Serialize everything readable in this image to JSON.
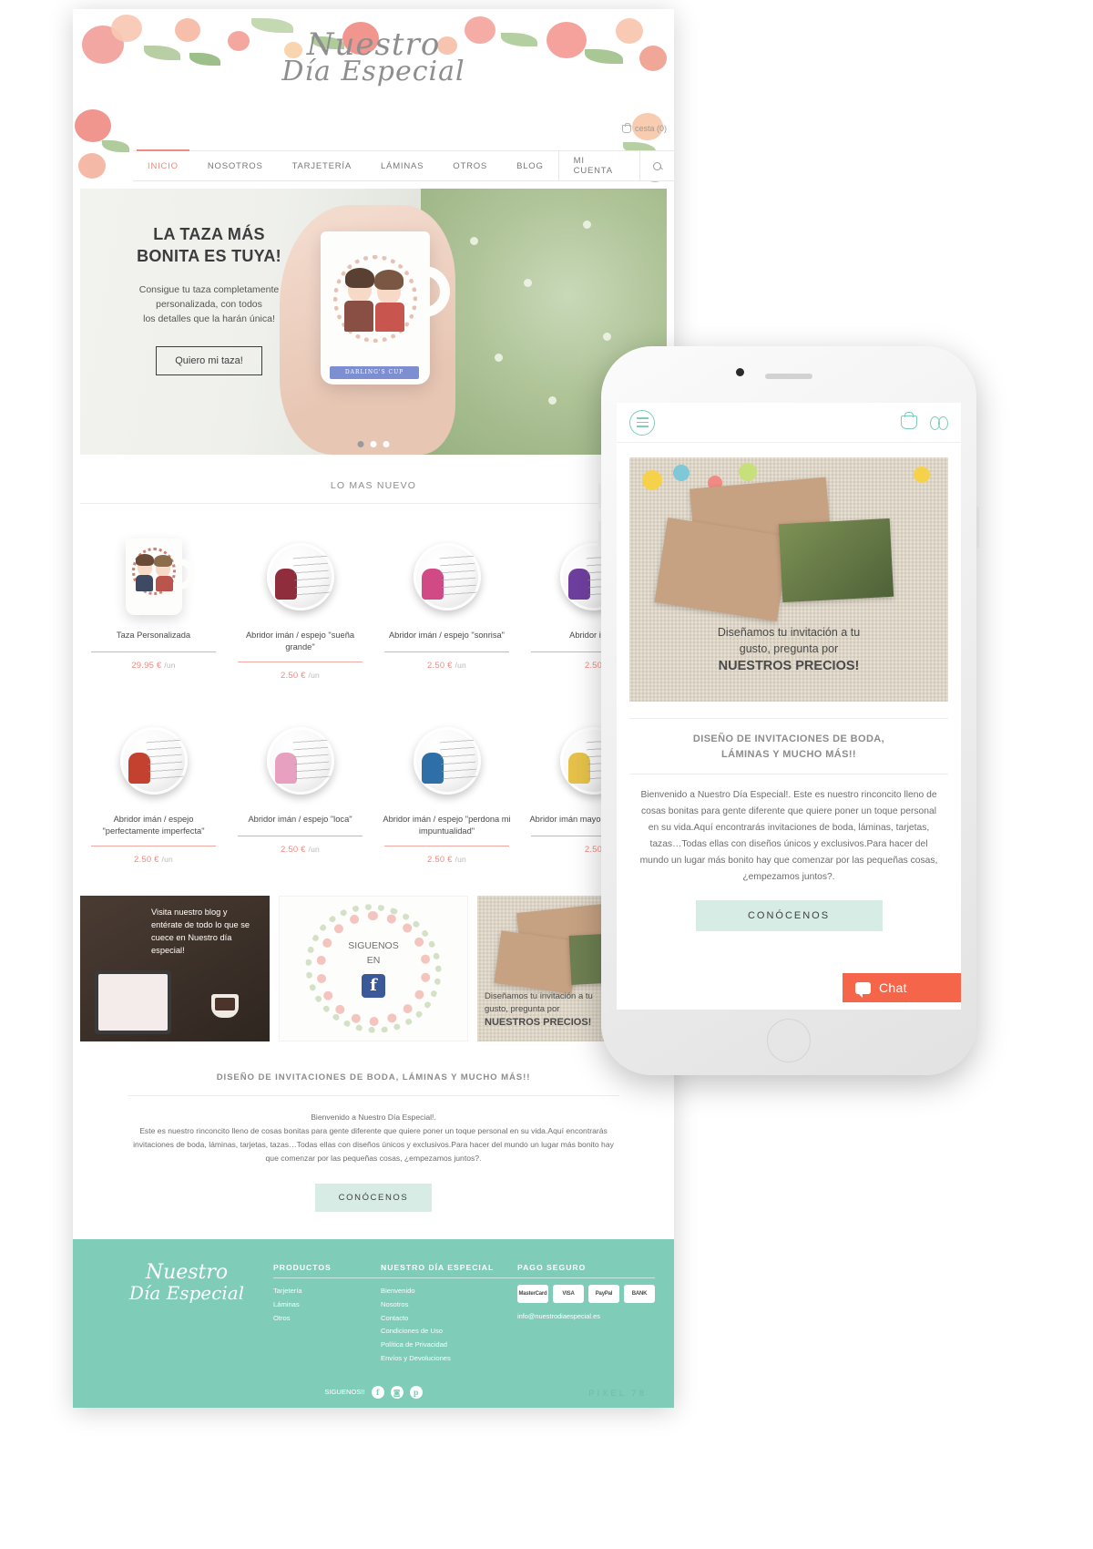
{
  "brand": {
    "name_line1": "Nuestro",
    "name_line2": "Día Especial",
    "accent": "#f08a82",
    "teal": "#7fcdb9",
    "teal_light": "#d6ece4",
    "chat_color": "#f4654a"
  },
  "header": {
    "cart_label": "cesta (0)",
    "cart_icon": "basket-icon",
    "search_icon": "search-icon"
  },
  "nav": {
    "items": [
      {
        "label": "INICIO",
        "active": true
      },
      {
        "label": "NOSOTROS",
        "active": false
      },
      {
        "label": "TARJETERÍA",
        "active": false
      },
      {
        "label": "LÁMINAS",
        "active": false
      },
      {
        "label": "OTROS",
        "active": false
      },
      {
        "label": "BLOG",
        "active": false
      },
      {
        "label": "MI CUENTA",
        "active": false
      }
    ]
  },
  "hero": {
    "heading_line1": "LA TAZA MÁS",
    "heading_line2": "BONITA ES TUYA!",
    "paragraph_line1": "Consigue tu taza completamente",
    "paragraph_line2": "personalizada, con todos",
    "paragraph_line3": "los detalles que la harán única!",
    "button_label": "Quiero mi taza!",
    "mug_ribbon": "DARLING'S CUP",
    "slides_total": 3,
    "slide_active": 1
  },
  "products_section": {
    "title": "LO MAS NUEVO",
    "items": [
      {
        "name": "Taza Personalizada",
        "price": "29.95 €",
        "unit": "/un",
        "kind": "mug"
      },
      {
        "name": "Abridor imán / espejo \"sueña grande\"",
        "price": "2.50 €",
        "unit": "/un",
        "kind": "badge"
      },
      {
        "name": "Abridor imán / espejo \"sonrisa\"",
        "price": "2.50 €",
        "unit": "/un",
        "kind": "badge"
      },
      {
        "name": "Abridor imán",
        "price": "2.50",
        "unit": "",
        "kind": "badge"
      },
      {
        "name": "Abridor imán / espejo \"perfectamente imperfecta\"",
        "price": "2.50 €",
        "unit": "/un",
        "kind": "badge"
      },
      {
        "name": "Abridor imán / espejo \"loca\"",
        "price": "2.50 €",
        "unit": "/un",
        "kind": "badge"
      },
      {
        "name": "Abridor imán / espejo \"perdona mi impuntualidad\"",
        "price": "2.50 €",
        "unit": "/un",
        "kind": "badge"
      },
      {
        "name": "Abridor imán mayor fracaso interé",
        "price": "2.50",
        "unit": "",
        "kind": "badge"
      }
    ]
  },
  "promos": [
    {
      "id": "blog",
      "text": "Visita nuestro blog y entérate de todo lo que se cuece en Nuestro día especial!"
    },
    {
      "id": "facebook",
      "line1": "SIGUENOS",
      "line2": "EN",
      "icon": "facebook-icon"
    },
    {
      "id": "invitaciones",
      "line1": "Diseñamos tu invitación a tu",
      "line2": "gusto, pregunta por",
      "strong": "NUESTROS PRECIOS!"
    }
  ],
  "about": {
    "heading": "DISEÑO DE INVITACIONES DE BODA, LÁMINAS Y MUCHO MÁS!!",
    "line1": "Bienvenido a Nuestro Día Especial!.",
    "line2": "Este es nuestro rinconcito lleno de cosas bonitas para gente diferente que quiere poner un toque personal en su vida.Aquí encontrarás invitaciones de boda, láminas, tarjetas, tazas…Todas ellas con diseños únicos y exclusivos.Para hacer del mundo un lugar más bonito hay que comenzar por las pequeñas cosas, ¿empezamos juntos?.",
    "cta": "CONÓCENOS"
  },
  "footer": {
    "columns": [
      {
        "title": "PRODUCTOS",
        "links": [
          "Tarjetería",
          "Láminas",
          "Otros"
        ]
      },
      {
        "title": "NUESTRO DÍA ESPECIAL",
        "links": [
          "Bienvenido",
          "Nosotros",
          "Contacto",
          "Condiciones de Uso",
          "Política de Privacidad",
          "Envíos y Devoluciones"
        ]
      },
      {
        "title": "PAGO SEGURO",
        "links": []
      }
    ],
    "payments": [
      "MasterCard",
      "VISA",
      "PayPal",
      "BANK"
    ],
    "email": "info@nuestrodiaespecial.es",
    "follow_label": "SIGUENOS!!",
    "social": [
      "f",
      "◙",
      "p"
    ],
    "credit": "PIXEL 78"
  },
  "phone": {
    "menu_icon": "hamburger-icon",
    "basket_icon": "basket-icon",
    "bow_icon": "bow-icon",
    "hero": {
      "line1": "Diseñamos tu invitación a tu",
      "line2": "gusto, pregunta por",
      "strong": "NUESTROS PRECIOS!"
    },
    "heading_line1": "DISEÑO DE INVITACIONES DE BODA,",
    "heading_line2": "LÁMINAS Y MUCHO MÁS!!",
    "body": "Bienvenido a Nuestro Día Especial!. Este es nuestro rinconcito lleno de cosas bonitas para gente diferente que quiere poner un toque personal en su vida.Aquí encontrarás invitaciones de boda, láminas, tarjetas, tazas…Todas ellas con diseños únicos y exclusivos.Para hacer del mundo un lugar más bonito hay que comenzar por las pequeñas cosas, ¿empezamos juntos?.",
    "cta": "CONÓCENOS",
    "chat_label": "Chat"
  }
}
